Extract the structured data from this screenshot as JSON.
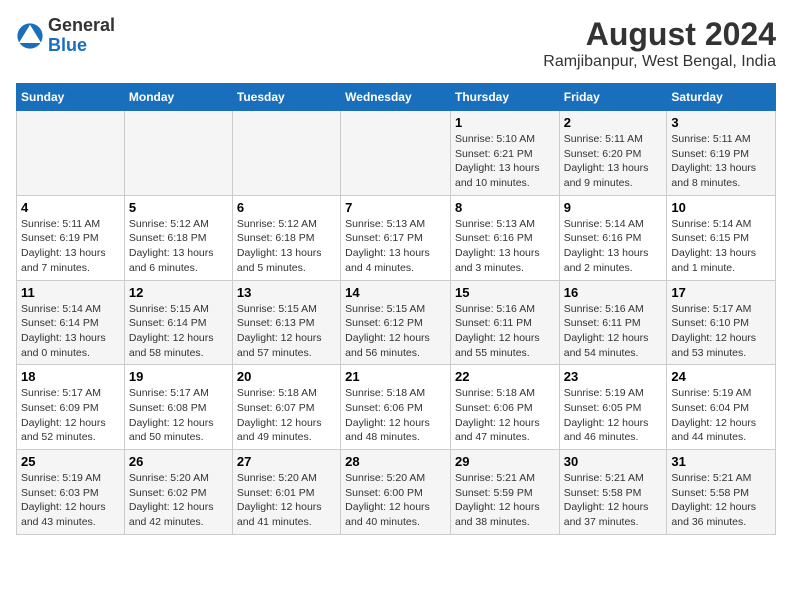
{
  "header": {
    "logo_general": "General",
    "logo_blue": "Blue",
    "title": "August 2024",
    "subtitle": "Ramjibanpur, West Bengal, India"
  },
  "days_of_week": [
    "Sunday",
    "Monday",
    "Tuesday",
    "Wednesday",
    "Thursday",
    "Friday",
    "Saturday"
  ],
  "weeks": [
    [
      {
        "day": "",
        "detail": ""
      },
      {
        "day": "",
        "detail": ""
      },
      {
        "day": "",
        "detail": ""
      },
      {
        "day": "",
        "detail": ""
      },
      {
        "day": "1",
        "detail": "Sunrise: 5:10 AM\nSunset: 6:21 PM\nDaylight: 13 hours\nand 10 minutes."
      },
      {
        "day": "2",
        "detail": "Sunrise: 5:11 AM\nSunset: 6:20 PM\nDaylight: 13 hours\nand 9 minutes."
      },
      {
        "day": "3",
        "detail": "Sunrise: 5:11 AM\nSunset: 6:19 PM\nDaylight: 13 hours\nand 8 minutes."
      }
    ],
    [
      {
        "day": "4",
        "detail": "Sunrise: 5:11 AM\nSunset: 6:19 PM\nDaylight: 13 hours\nand 7 minutes."
      },
      {
        "day": "5",
        "detail": "Sunrise: 5:12 AM\nSunset: 6:18 PM\nDaylight: 13 hours\nand 6 minutes."
      },
      {
        "day": "6",
        "detail": "Sunrise: 5:12 AM\nSunset: 6:18 PM\nDaylight: 13 hours\nand 5 minutes."
      },
      {
        "day": "7",
        "detail": "Sunrise: 5:13 AM\nSunset: 6:17 PM\nDaylight: 13 hours\nand 4 minutes."
      },
      {
        "day": "8",
        "detail": "Sunrise: 5:13 AM\nSunset: 6:16 PM\nDaylight: 13 hours\nand 3 minutes."
      },
      {
        "day": "9",
        "detail": "Sunrise: 5:14 AM\nSunset: 6:16 PM\nDaylight: 13 hours\nand 2 minutes."
      },
      {
        "day": "10",
        "detail": "Sunrise: 5:14 AM\nSunset: 6:15 PM\nDaylight: 13 hours\nand 1 minute."
      }
    ],
    [
      {
        "day": "11",
        "detail": "Sunrise: 5:14 AM\nSunset: 6:14 PM\nDaylight: 13 hours\nand 0 minutes."
      },
      {
        "day": "12",
        "detail": "Sunrise: 5:15 AM\nSunset: 6:14 PM\nDaylight: 12 hours\nand 58 minutes."
      },
      {
        "day": "13",
        "detail": "Sunrise: 5:15 AM\nSunset: 6:13 PM\nDaylight: 12 hours\nand 57 minutes."
      },
      {
        "day": "14",
        "detail": "Sunrise: 5:15 AM\nSunset: 6:12 PM\nDaylight: 12 hours\nand 56 minutes."
      },
      {
        "day": "15",
        "detail": "Sunrise: 5:16 AM\nSunset: 6:11 PM\nDaylight: 12 hours\nand 55 minutes."
      },
      {
        "day": "16",
        "detail": "Sunrise: 5:16 AM\nSunset: 6:11 PM\nDaylight: 12 hours\nand 54 minutes."
      },
      {
        "day": "17",
        "detail": "Sunrise: 5:17 AM\nSunset: 6:10 PM\nDaylight: 12 hours\nand 53 minutes."
      }
    ],
    [
      {
        "day": "18",
        "detail": "Sunrise: 5:17 AM\nSunset: 6:09 PM\nDaylight: 12 hours\nand 52 minutes."
      },
      {
        "day": "19",
        "detail": "Sunrise: 5:17 AM\nSunset: 6:08 PM\nDaylight: 12 hours\nand 50 minutes."
      },
      {
        "day": "20",
        "detail": "Sunrise: 5:18 AM\nSunset: 6:07 PM\nDaylight: 12 hours\nand 49 minutes."
      },
      {
        "day": "21",
        "detail": "Sunrise: 5:18 AM\nSunset: 6:06 PM\nDaylight: 12 hours\nand 48 minutes."
      },
      {
        "day": "22",
        "detail": "Sunrise: 5:18 AM\nSunset: 6:06 PM\nDaylight: 12 hours\nand 47 minutes."
      },
      {
        "day": "23",
        "detail": "Sunrise: 5:19 AM\nSunset: 6:05 PM\nDaylight: 12 hours\nand 46 minutes."
      },
      {
        "day": "24",
        "detail": "Sunrise: 5:19 AM\nSunset: 6:04 PM\nDaylight: 12 hours\nand 44 minutes."
      }
    ],
    [
      {
        "day": "25",
        "detail": "Sunrise: 5:19 AM\nSunset: 6:03 PM\nDaylight: 12 hours\nand 43 minutes."
      },
      {
        "day": "26",
        "detail": "Sunrise: 5:20 AM\nSunset: 6:02 PM\nDaylight: 12 hours\nand 42 minutes."
      },
      {
        "day": "27",
        "detail": "Sunrise: 5:20 AM\nSunset: 6:01 PM\nDaylight: 12 hours\nand 41 minutes."
      },
      {
        "day": "28",
        "detail": "Sunrise: 5:20 AM\nSunset: 6:00 PM\nDaylight: 12 hours\nand 40 minutes."
      },
      {
        "day": "29",
        "detail": "Sunrise: 5:21 AM\nSunset: 5:59 PM\nDaylight: 12 hours\nand 38 minutes."
      },
      {
        "day": "30",
        "detail": "Sunrise: 5:21 AM\nSunset: 5:58 PM\nDaylight: 12 hours\nand 37 minutes."
      },
      {
        "day": "31",
        "detail": "Sunrise: 5:21 AM\nSunset: 5:58 PM\nDaylight: 12 hours\nand 36 minutes."
      }
    ]
  ]
}
